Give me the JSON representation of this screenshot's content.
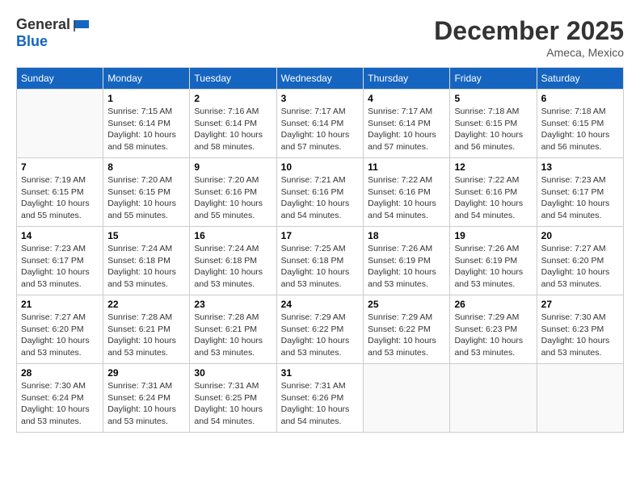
{
  "header": {
    "logo_general": "General",
    "logo_blue": "Blue",
    "month_year": "December 2025",
    "location": "Ameca, Mexico"
  },
  "weekdays": [
    "Sunday",
    "Monday",
    "Tuesday",
    "Wednesday",
    "Thursday",
    "Friday",
    "Saturday"
  ],
  "weeks": [
    [
      {
        "day": "",
        "sunrise": "",
        "sunset": "",
        "daylight": ""
      },
      {
        "day": "1",
        "sunrise": "Sunrise: 7:15 AM",
        "sunset": "Sunset: 6:14 PM",
        "daylight": "Daylight: 10 hours and 58 minutes."
      },
      {
        "day": "2",
        "sunrise": "Sunrise: 7:16 AM",
        "sunset": "Sunset: 6:14 PM",
        "daylight": "Daylight: 10 hours and 58 minutes."
      },
      {
        "day": "3",
        "sunrise": "Sunrise: 7:17 AM",
        "sunset": "Sunset: 6:14 PM",
        "daylight": "Daylight: 10 hours and 57 minutes."
      },
      {
        "day": "4",
        "sunrise": "Sunrise: 7:17 AM",
        "sunset": "Sunset: 6:14 PM",
        "daylight": "Daylight: 10 hours and 57 minutes."
      },
      {
        "day": "5",
        "sunrise": "Sunrise: 7:18 AM",
        "sunset": "Sunset: 6:15 PM",
        "daylight": "Daylight: 10 hours and 56 minutes."
      },
      {
        "day": "6",
        "sunrise": "Sunrise: 7:18 AM",
        "sunset": "Sunset: 6:15 PM",
        "daylight": "Daylight: 10 hours and 56 minutes."
      }
    ],
    [
      {
        "day": "7",
        "sunrise": "Sunrise: 7:19 AM",
        "sunset": "Sunset: 6:15 PM",
        "daylight": "Daylight: 10 hours and 55 minutes."
      },
      {
        "day": "8",
        "sunrise": "Sunrise: 7:20 AM",
        "sunset": "Sunset: 6:15 PM",
        "daylight": "Daylight: 10 hours and 55 minutes."
      },
      {
        "day": "9",
        "sunrise": "Sunrise: 7:20 AM",
        "sunset": "Sunset: 6:16 PM",
        "daylight": "Daylight: 10 hours and 55 minutes."
      },
      {
        "day": "10",
        "sunrise": "Sunrise: 7:21 AM",
        "sunset": "Sunset: 6:16 PM",
        "daylight": "Daylight: 10 hours and 54 minutes."
      },
      {
        "day": "11",
        "sunrise": "Sunrise: 7:22 AM",
        "sunset": "Sunset: 6:16 PM",
        "daylight": "Daylight: 10 hours and 54 minutes."
      },
      {
        "day": "12",
        "sunrise": "Sunrise: 7:22 AM",
        "sunset": "Sunset: 6:16 PM",
        "daylight": "Daylight: 10 hours and 54 minutes."
      },
      {
        "day": "13",
        "sunrise": "Sunrise: 7:23 AM",
        "sunset": "Sunset: 6:17 PM",
        "daylight": "Daylight: 10 hours and 54 minutes."
      }
    ],
    [
      {
        "day": "14",
        "sunrise": "Sunrise: 7:23 AM",
        "sunset": "Sunset: 6:17 PM",
        "daylight": "Daylight: 10 hours and 53 minutes."
      },
      {
        "day": "15",
        "sunrise": "Sunrise: 7:24 AM",
        "sunset": "Sunset: 6:18 PM",
        "daylight": "Daylight: 10 hours and 53 minutes."
      },
      {
        "day": "16",
        "sunrise": "Sunrise: 7:24 AM",
        "sunset": "Sunset: 6:18 PM",
        "daylight": "Daylight: 10 hours and 53 minutes."
      },
      {
        "day": "17",
        "sunrise": "Sunrise: 7:25 AM",
        "sunset": "Sunset: 6:18 PM",
        "daylight": "Daylight: 10 hours and 53 minutes."
      },
      {
        "day": "18",
        "sunrise": "Sunrise: 7:26 AM",
        "sunset": "Sunset: 6:19 PM",
        "daylight": "Daylight: 10 hours and 53 minutes."
      },
      {
        "day": "19",
        "sunrise": "Sunrise: 7:26 AM",
        "sunset": "Sunset: 6:19 PM",
        "daylight": "Daylight: 10 hours and 53 minutes."
      },
      {
        "day": "20",
        "sunrise": "Sunrise: 7:27 AM",
        "sunset": "Sunset: 6:20 PM",
        "daylight": "Daylight: 10 hours and 53 minutes."
      }
    ],
    [
      {
        "day": "21",
        "sunrise": "Sunrise: 7:27 AM",
        "sunset": "Sunset: 6:20 PM",
        "daylight": "Daylight: 10 hours and 53 minutes."
      },
      {
        "day": "22",
        "sunrise": "Sunrise: 7:28 AM",
        "sunset": "Sunset: 6:21 PM",
        "daylight": "Daylight: 10 hours and 53 minutes."
      },
      {
        "day": "23",
        "sunrise": "Sunrise: 7:28 AM",
        "sunset": "Sunset: 6:21 PM",
        "daylight": "Daylight: 10 hours and 53 minutes."
      },
      {
        "day": "24",
        "sunrise": "Sunrise: 7:29 AM",
        "sunset": "Sunset: 6:22 PM",
        "daylight": "Daylight: 10 hours and 53 minutes."
      },
      {
        "day": "25",
        "sunrise": "Sunrise: 7:29 AM",
        "sunset": "Sunset: 6:22 PM",
        "daylight": "Daylight: 10 hours and 53 minutes."
      },
      {
        "day": "26",
        "sunrise": "Sunrise: 7:29 AM",
        "sunset": "Sunset: 6:23 PM",
        "daylight": "Daylight: 10 hours and 53 minutes."
      },
      {
        "day": "27",
        "sunrise": "Sunrise: 7:30 AM",
        "sunset": "Sunset: 6:23 PM",
        "daylight": "Daylight: 10 hours and 53 minutes."
      }
    ],
    [
      {
        "day": "28",
        "sunrise": "Sunrise: 7:30 AM",
        "sunset": "Sunset: 6:24 PM",
        "daylight": "Daylight: 10 hours and 53 minutes."
      },
      {
        "day": "29",
        "sunrise": "Sunrise: 7:31 AM",
        "sunset": "Sunset: 6:24 PM",
        "daylight": "Daylight: 10 hours and 53 minutes."
      },
      {
        "day": "30",
        "sunrise": "Sunrise: 7:31 AM",
        "sunset": "Sunset: 6:25 PM",
        "daylight": "Daylight: 10 hours and 54 minutes."
      },
      {
        "day": "31",
        "sunrise": "Sunrise: 7:31 AM",
        "sunset": "Sunset: 6:26 PM",
        "daylight": "Daylight: 10 hours and 54 minutes."
      },
      {
        "day": "",
        "sunrise": "",
        "sunset": "",
        "daylight": ""
      },
      {
        "day": "",
        "sunrise": "",
        "sunset": "",
        "daylight": ""
      },
      {
        "day": "",
        "sunrise": "",
        "sunset": "",
        "daylight": ""
      }
    ]
  ]
}
